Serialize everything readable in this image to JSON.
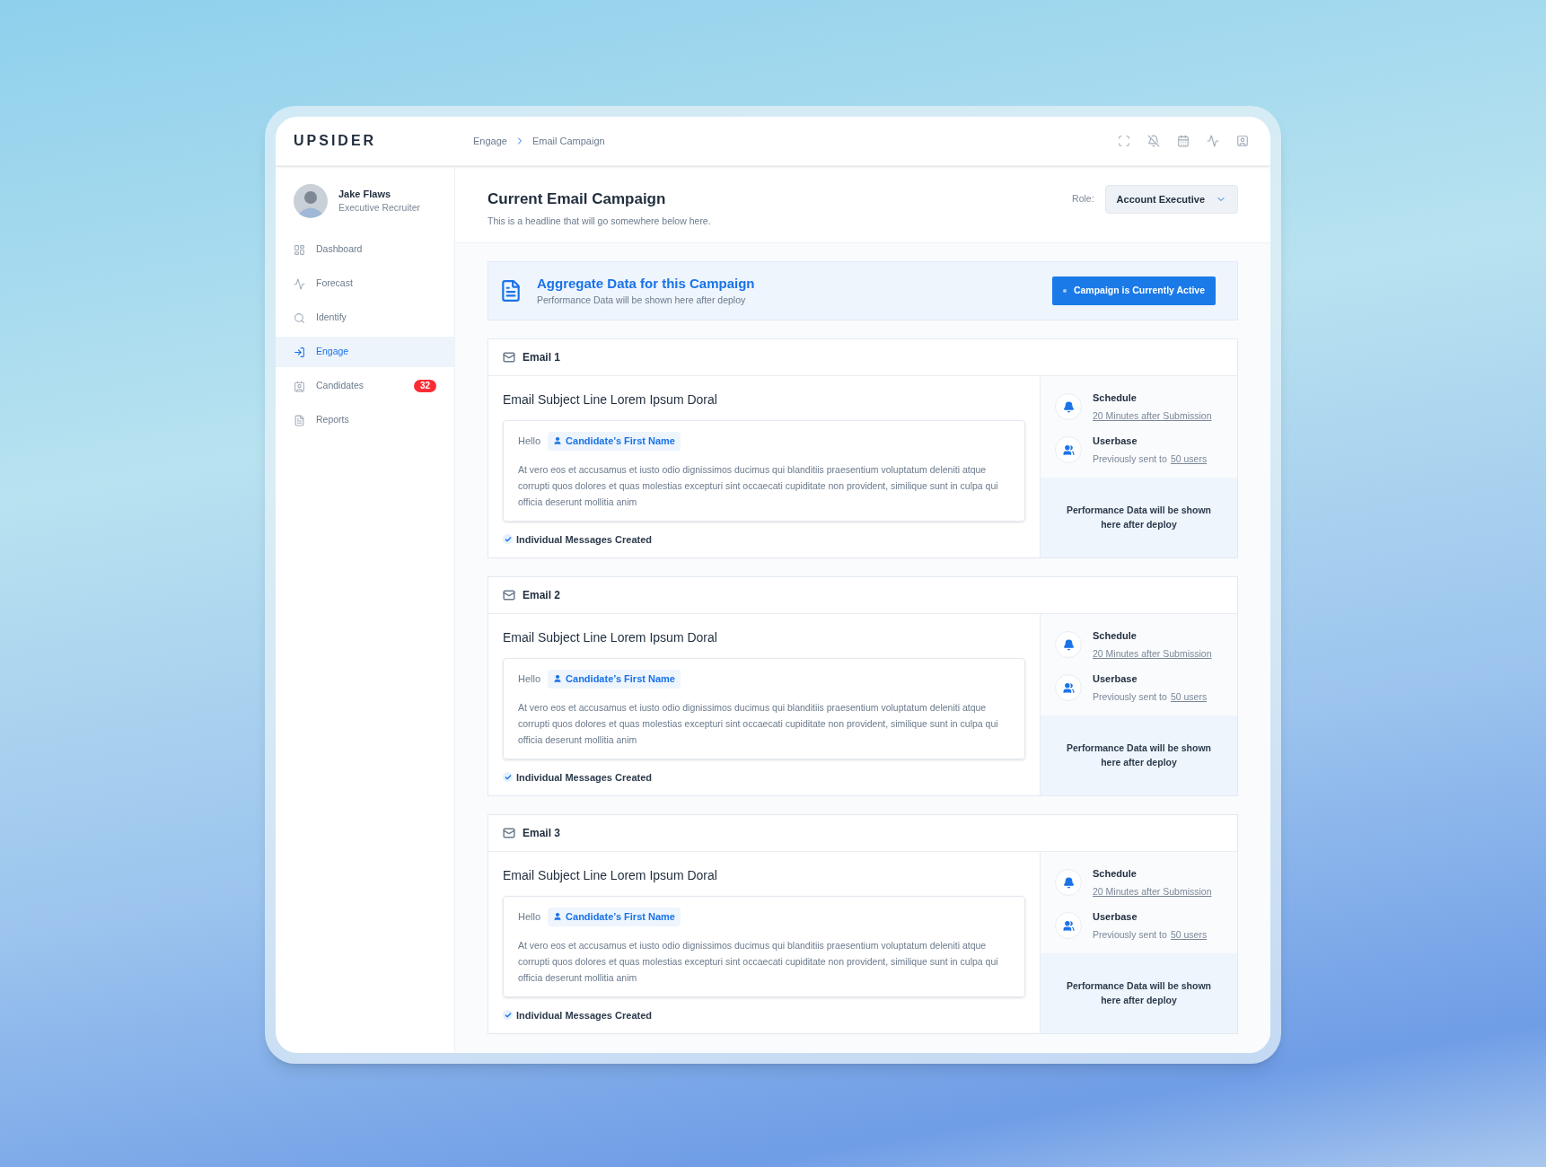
{
  "logo": "UPSIDER",
  "breadcrumb": [
    "Engage",
    "Email Campaign"
  ],
  "user": {
    "name": "Jake Flaws",
    "role": "Executive Recruiter"
  },
  "nav": [
    {
      "label": "Dashboard",
      "selected": false
    },
    {
      "label": "Forecast",
      "selected": false
    },
    {
      "label": "Identify",
      "selected": false
    },
    {
      "label": "Engage",
      "selected": true
    },
    {
      "label": "Candidates",
      "selected": false,
      "badge": "32"
    },
    {
      "label": "Reports",
      "selected": false
    }
  ],
  "page": {
    "title": "Current Email Campaign",
    "subtitle": "This is a headline that will go somewhere below here.",
    "role_label": "Role:",
    "role_value": "Account Executive"
  },
  "banner": {
    "title": "Aggregate Data for this Campaign",
    "subtitle": "Performance Data will be shown here after deploy",
    "button": "Campaign is Currently Active"
  },
  "emails": [
    {
      "title": "Email 1",
      "subject": "Email Subject Line Lorem Ipsum Doral",
      "greeting": "Hello",
      "token": "Candidate’s First Name",
      "body": "At vero eos et accusamus et iusto odio dignissimos ducimus qui blanditiis praesentium voluptatum deleniti atque corrupti quos dolores et quas molestias excepturi sint occaecati cupiditate non provident, similique sunt in culpa qui officia deserunt mollitia anim",
      "status": "Individual Messages Created",
      "checked": true,
      "schedule_label": "Schedule",
      "schedule_value": "20 Minutes after Submission",
      "userbase_label": "Userbase",
      "userbase_prefix": "Previously sent to",
      "userbase_link": "50 users",
      "performance": "Performance Data will be shown here after deploy"
    },
    {
      "title": "Email 2",
      "subject": "Email Subject Line Lorem Ipsum Doral",
      "greeting": "Hello",
      "token": "Candidate’s First Name",
      "body": "At vero eos et accusamus et iusto odio dignissimos ducimus qui blanditiis praesentium voluptatum deleniti atque corrupti quos dolores et quas molestias excepturi sint occaecati cupiditate non provident, similique sunt in culpa qui officia deserunt mollitia anim",
      "status": "Individual Messages Created",
      "checked": true,
      "schedule_label": "Schedule",
      "schedule_value": "20 Minutes after Submission",
      "userbase_label": "Userbase",
      "userbase_prefix": "Previously sent to",
      "userbase_link": "50 users",
      "performance": "Performance Data will be shown here after deploy"
    },
    {
      "title": "Email 3",
      "subject": "Email Subject Line Lorem Ipsum Doral",
      "greeting": "Hello",
      "token": "Candidate’s First Name",
      "body": "At vero eos et accusamus et iusto odio dignissimos ducimus qui blanditiis praesentium voluptatum deleniti atque corrupti quos dolores et quas molestias excepturi sint occaecati cupiditate non provident, similique sunt in culpa qui officia deserunt mollitia anim",
      "status": "Individual Messages Created",
      "checked": true,
      "schedule_label": "Schedule",
      "schedule_value": "20 Minutes after Submission",
      "userbase_label": "Userbase",
      "userbase_prefix": "Previously sent to",
      "userbase_link": "50 users",
      "performance": "Performance Data will be shown here after deploy"
    }
  ]
}
